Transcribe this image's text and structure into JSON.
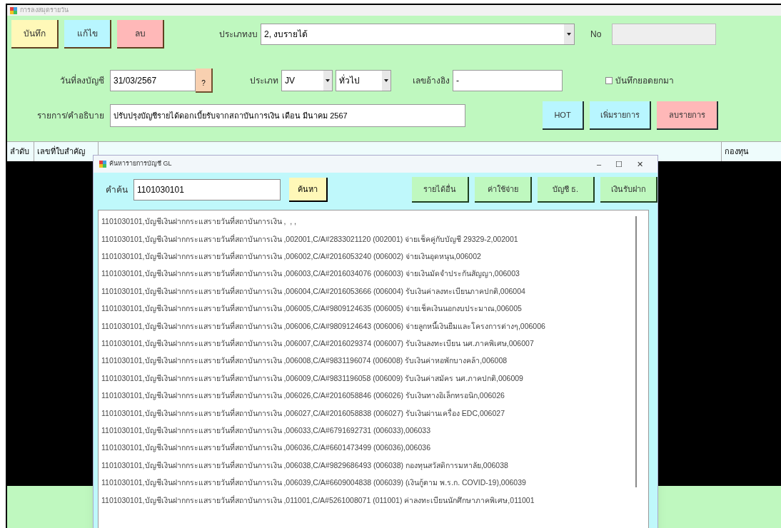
{
  "window": {
    "title": "การลงสมุดรายวัน"
  },
  "toolbar": [
    {
      "label": "บันทึก",
      "color": "#fff8b8"
    },
    {
      "label": "แก้ไข",
      "color": "#b8f6ff"
    },
    {
      "label": "ลบ",
      "color": "#ffb8b8"
    }
  ],
  "budget_type": {
    "label": "ประเภทงบ",
    "value": "2, งบรายได้"
  },
  "number": {
    "label": "No"
  },
  "post_date": {
    "label": "วันที่ลงบัญชี",
    "value": "31/03/2567",
    "button": "?"
  },
  "voucher_type": {
    "label": "ประเภท",
    "value": "JV",
    "subtype": "ทั่วไป"
  },
  "reference": {
    "label": "เลขอ้างอิง",
    "value": "-"
  },
  "carry_forward": {
    "label": "บันทึกยอดยกมา",
    "checked": false
  },
  "description": {
    "label": "รายการ/คำอธิบาย",
    "value": "ปรับปรุงบัญชีรายได้ดอกเบี้ยรับจากสถาบันการเงิน เดือน มีนาคม 2567"
  },
  "actions": [
    {
      "label": "HOT",
      "color": "#b8f6ff"
    },
    {
      "label": "เพิ่มรายการ",
      "color": "#b8f6ff"
    },
    {
      "label": "ลบรายการ",
      "color": "#ffb8b8"
    }
  ],
  "table": {
    "columns": [
      "ลำดับ",
      "เลขที่ใบสำคัญ",
      "กองทุน"
    ]
  },
  "dialog": {
    "title": "ค้นหารายการบัญชี GL",
    "controls": [
      "–",
      "☐",
      "✕"
    ],
    "search": {
      "label": "คำค้น",
      "value": "1101030101",
      "button": "ค้นหา"
    },
    "filters": [
      "รายได้อื่น",
      "ค่าใช้จ่าย",
      "บัญชี ธ.",
      "เงินรับฝาก"
    ],
    "results": [
      "1101030101,บัญชีเงินฝากกระแสรายวันที่สถาบันการเงิน ,  , ,",
      "1101030101,บัญชีเงินฝากกระแสรายวันที่สถาบันการเงิน ,002001,C/A#2833021120 (002001) จ่ายเช็คคู่กับบัญชี 29329-2,002001",
      "1101030101,บัญชีเงินฝากกระแสรายวันที่สถาบันการเงิน ,006002,C/A#2016053240 (006002) จ่ายเงินอุดหนุน,006002",
      "1101030101,บัญชีเงินฝากกระแสรายวันที่สถาบันการเงิน ,006003,C/A#2016034076 (006003) จ่ายเงินมัดจำประกันสัญญา,006003",
      "1101030101,บัญชีเงินฝากกระแสรายวันที่สถาบันการเงิน ,006004,C/A#2016053666 (006004) รับเงินค่าลงทะเบียนภาคปกติ,006004",
      "1101030101,บัญชีเงินฝากกระแสรายวันที่สถาบันการเงิน ,006005,C/A#9809124635 (006005) จ่ายเช็คเงินนอกงบประมาณ,006005",
      "1101030101,บัญชีเงินฝากกระแสรายวันที่สถาบันการเงิน ,006006,C/A#9809124643 (006006) จ่ายลูกหนี้เงินยืมและโครงการต่างๆ,006006",
      "1101030101,บัญชีเงินฝากกระแสรายวันที่สถาบันการเงิน ,006007,C/A#2016029374 (006007) รับเงินลงทะเบียน นศ.ภาคพิเศษ,006007",
      "1101030101,บัญชีเงินฝากกระแสรายวันที่สถาบันการเงิน ,006008,C/A#9831196074 (006008) รับเงินค่าหอพักบางคล้า,006008",
      "1101030101,บัญชีเงินฝากกระแสรายวันที่สถาบันการเงิน ,006009,C/A#9831196058 (006009) รับเงินค่าสมัคร นศ.ภาคปกติ,006009",
      "1101030101,บัญชีเงินฝากกระแสรายวันที่สถาบันการเงิน ,006026,C/A#2016058846 (006026) รับเงินทางอิเล็กทรอนิก,006026",
      "1101030101,บัญชีเงินฝากกระแสรายวันที่สถาบันการเงิน ,006027,C/A#2016058838 (006027) รับเงินผ่านเครื่อง EDC,006027",
      "1101030101,บัญชีเงินฝากกระแสรายวันที่สถาบันการเงิน ,006033,C/A#6791692731 (006033),006033",
      "1101030101,บัญชีเงินฝากกระแสรายวันที่สถาบันการเงิน ,006036,C/A#6601473499 (006036),006036",
      "1101030101,บัญชีเงินฝากกระแสรายวันที่สถาบันการเงิน ,006038,C/A#9829686493 (006038) กองทุนสวัสดิการมหาลัย,006038",
      "1101030101,บัญชีเงินฝากกระแสรายวันที่สถาบันการเงิน ,006039,C/A#6609004838 (006039) (เงินกู้ตาม พ.ร.ก. COVID-19),006039",
      "1101030101,บัญชีเงินฝากกระแสรายวันที่สถาบันการเงิน ,011001,C/A#5261008071 (011001) ค่าลงทะเบียนนักศึกษาภาคพิเศษ,011001"
    ]
  }
}
